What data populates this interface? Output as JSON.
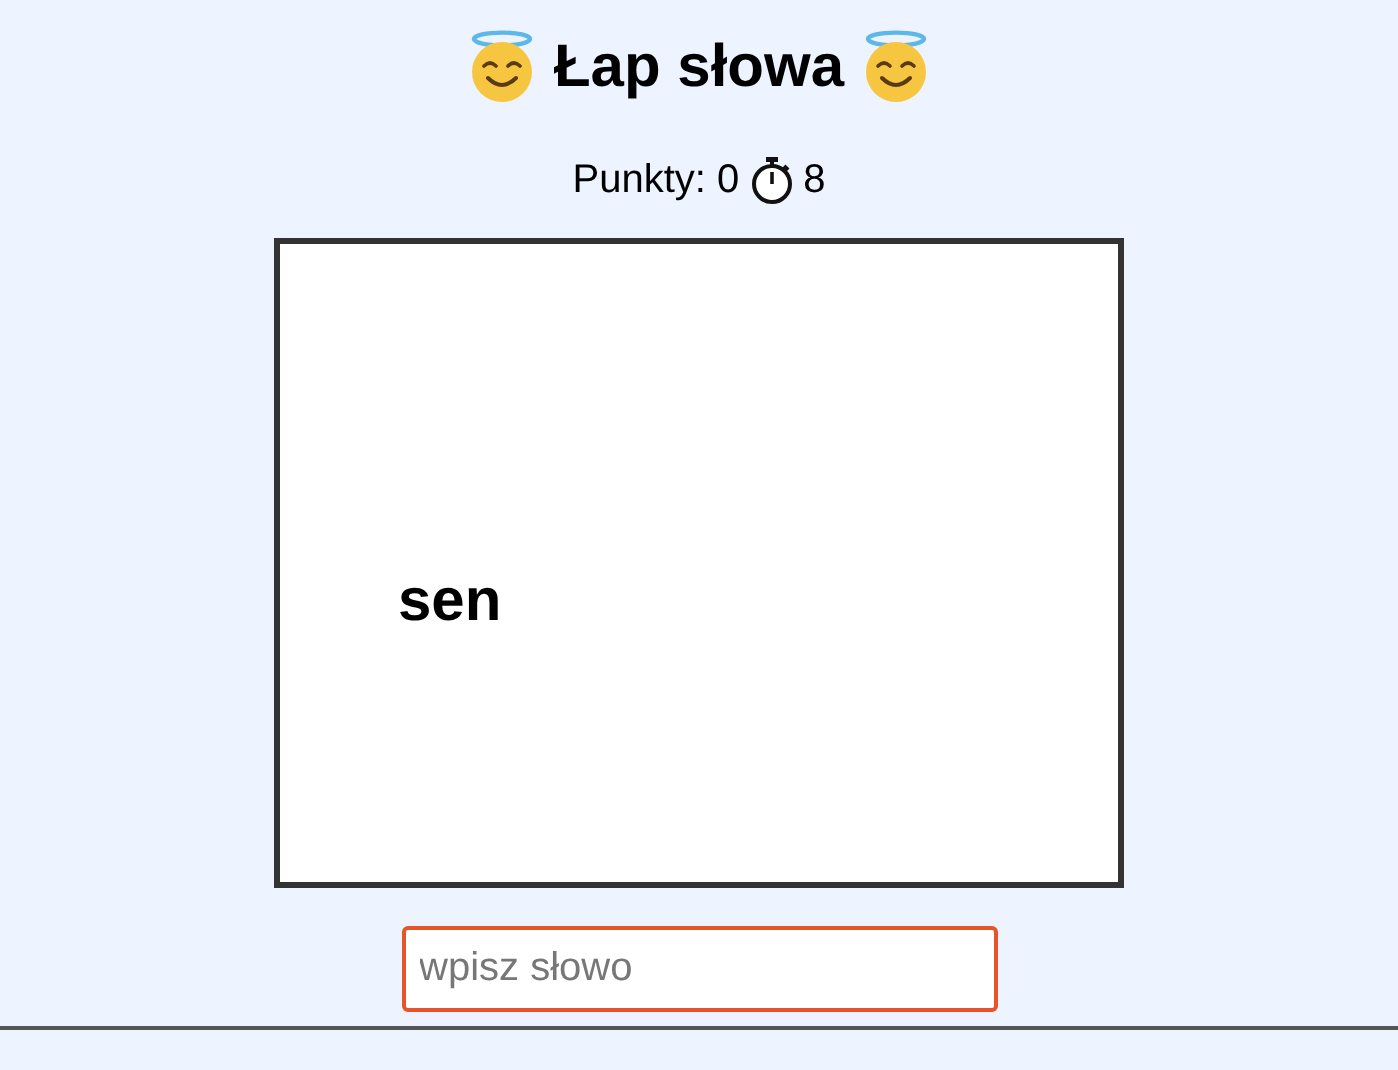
{
  "title": "Łap słowa",
  "score": {
    "points": "Punkty: 0",
    "time": "8"
  },
  "words": [
    {
      "text": "sen"
    }
  ],
  "input": {
    "placeholder": "wpisz słowo",
    "focused": true
  }
}
